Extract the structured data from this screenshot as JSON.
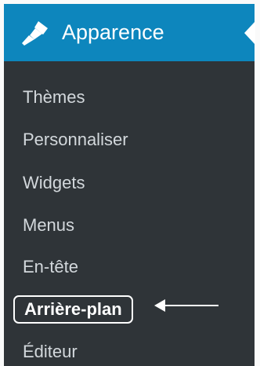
{
  "header": {
    "title": "Apparence",
    "icon": "paintbrush-icon",
    "background": "#0d86bd"
  },
  "submenu": {
    "items": [
      {
        "label": "Thèmes"
      },
      {
        "label": "Personnaliser"
      },
      {
        "label": "Widgets"
      },
      {
        "label": "Menus"
      },
      {
        "label": "En-tête"
      },
      {
        "label": "Arrière-plan",
        "active": true
      },
      {
        "label": "Éditeur"
      }
    ]
  },
  "annotation": {
    "icon": "left-arrow-icon",
    "color": "#ffffff"
  }
}
